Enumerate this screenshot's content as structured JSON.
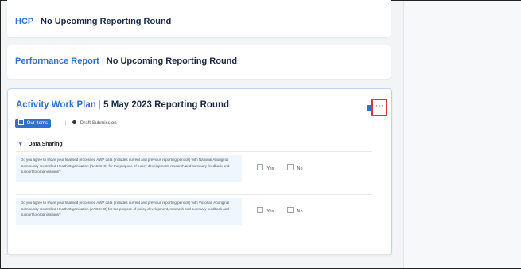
{
  "cards": [
    {
      "title_main": "HCP",
      "title_sub": "No Upcoming Reporting Round"
    },
    {
      "title_main": "Performance Report",
      "title_sub": "No Upcoming Reporting Round"
    },
    {
      "title_main": "Activity Work Plan",
      "title_sub": "5 May 2023 Reporting Round",
      "separator": "|",
      "more_label": "···",
      "tag_label": "Our Items",
      "status_pipe": "|",
      "status_label": "Draft Submission",
      "section_title": "Data Sharing",
      "questions": [
        {
          "text": "Do you agree to share your finalised processed AWP data (includes current and previous reporting periods) with National Aboriginal Community Controlled Health Organisation (NACCHO) for the purpose of policy development, research and summary feedback and support to organisations?",
          "yes_label": "Yes",
          "no_label": "No"
        },
        {
          "text": "Do you agree to share your finalised processed AWP data (includes current and previous reporting periods) with Victorian Aboriginal Community Controlled Health Organisation (VACCHO) for the purpose of policy development, research and summary feedback and support to organisations?",
          "yes_label": "Yes",
          "no_label": "No"
        }
      ]
    }
  ],
  "colors": {
    "accent": "#2f72c6",
    "highlight_border": "#d43a3a",
    "question_bg": "#f0f6fd"
  },
  "icons": {
    "action": "file-icon",
    "more": "more-horizontal-icon",
    "tag": "list-icon",
    "status": "status-dot-icon",
    "section": "chevron-down-icon"
  }
}
